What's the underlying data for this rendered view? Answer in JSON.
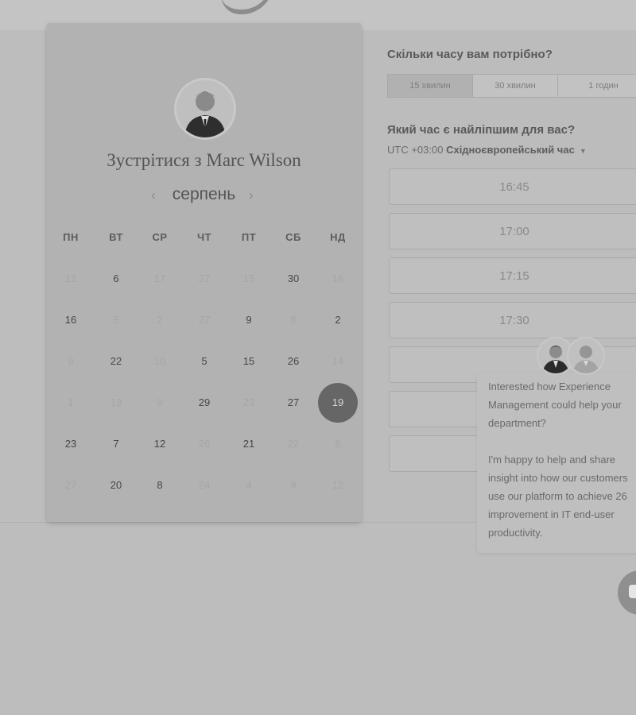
{
  "host": {
    "meet_title": "Зустрітися з Marc Wilson",
    "avatar_icon": "person-avatar-icon"
  },
  "calendar": {
    "month": "серпень",
    "prev_icon": "chevron-left-icon",
    "next_icon": "chevron-right-icon",
    "weekdays": [
      "ПН",
      "ВТ",
      "СР",
      "ЧТ",
      "ПТ",
      "СБ",
      "НД"
    ],
    "weeks": [
      [
        "12",
        "6",
        "17",
        "27",
        "15",
        "30",
        "16"
      ],
      [
        "16",
        "5",
        "2",
        "27",
        "9",
        "8",
        "2"
      ],
      [
        "9",
        "22",
        "10",
        "5",
        "15",
        "26",
        "14"
      ],
      [
        "1",
        "13",
        "9",
        "29",
        "23",
        "27",
        "19"
      ],
      [
        "23",
        "7",
        "12",
        "26",
        "21",
        "22",
        "6"
      ],
      [
        "27",
        "20",
        "8",
        "24",
        "4",
        "9",
        "12"
      ]
    ],
    "selected_day": "19"
  },
  "duration": {
    "question": "Скільки часу вам потрібно?",
    "options": [
      "15 хвилин",
      "30 хвилин",
      "1 годин"
    ],
    "selected": "15 хвилин"
  },
  "time": {
    "question": "Який час є найліпшим для вас?",
    "tz_offset": "UTC +03:00",
    "tz_name": "Східноєвропейський час",
    "tz_caret_icon": "caret-down-icon",
    "slots": [
      "16:45",
      "17:00",
      "17:15",
      "17:30",
      "",
      "",
      ""
    ]
  },
  "chat": {
    "paragraph1": [
      "Interested how Experience",
      "Management could help your",
      "department?"
    ],
    "paragraph2": [
      "I'm happy to help and share",
      "insight into how our customers",
      "use our platform to achieve 26",
      "improvement in IT end-user",
      "productivity."
    ],
    "launcher_icon": "chat-bubble-icon"
  },
  "colors": {
    "selected_day_bg": "#666666",
    "page_bg": "#bdbdbd",
    "card_bg": "#b2b2b2"
  }
}
